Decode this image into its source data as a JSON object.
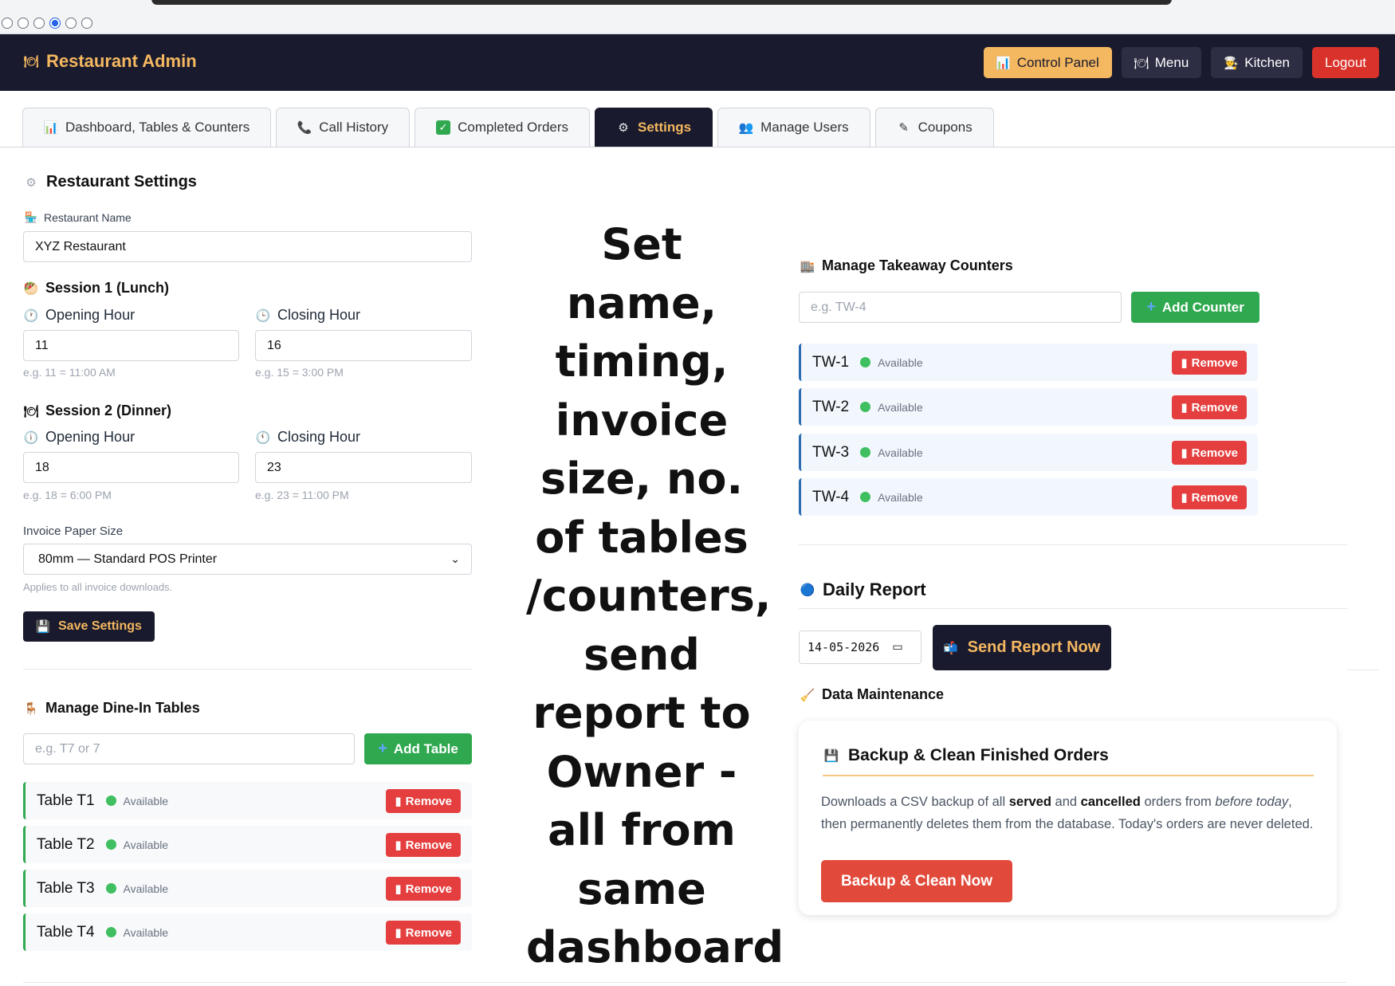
{
  "browser": {
    "dots": 6,
    "active_dot": 4
  },
  "navbar": {
    "brand": "Restaurant Admin",
    "brand_icon": "plate-icon",
    "buttons": [
      {
        "label": "Control Panel",
        "icon": "chart-icon"
      },
      {
        "label": "Menu",
        "icon": "plate-icon"
      },
      {
        "label": "Kitchen",
        "icon": "chef-icon"
      },
      {
        "label": "Logout"
      }
    ]
  },
  "tabs": [
    {
      "label": "Dashboard, Tables & Counters",
      "icon": "chart-icon"
    },
    {
      "label": "Call History",
      "icon": "phone-icon"
    },
    {
      "label": "Completed Orders",
      "icon": "check-icon"
    },
    {
      "label": "Settings",
      "icon": "gear-icon",
      "active": true
    },
    {
      "label": "Manage Users",
      "icon": "users-icon"
    },
    {
      "label": "Coupons",
      "icon": "tag-icon"
    }
  ],
  "settings": {
    "title": "Restaurant Settings",
    "name_label": "Restaurant Name",
    "name_value": "XYZ Restaurant",
    "session1": {
      "title": "Session 1 (Lunch)",
      "opening_label": "Opening Hour",
      "opening_value": "11",
      "opening_hint": "e.g. 11 = 11:00 AM",
      "closing_label": "Closing Hour",
      "closing_value": "16",
      "closing_hint": "e.g. 15 = 3:00 PM"
    },
    "session2": {
      "title": "Session 2 (Dinner)",
      "opening_label": "Opening Hour",
      "opening_value": "18",
      "opening_hint": "e.g. 18 = 6:00 PM",
      "closing_label": "Closing Hour",
      "closing_value": "23",
      "closing_hint": "e.g. 23 = 11:00 PM"
    },
    "invoice_label": "Invoice Paper Size",
    "invoice_value": "80mm — Standard POS Printer",
    "invoice_hint": "Applies to all invoice downloads.",
    "save_label": "Save Settings"
  },
  "tables": {
    "title": "Manage Dine-In Tables",
    "input_placeholder": "e.g. T7 or 7",
    "add_label": "Add Table",
    "remove_label": "Remove",
    "items": [
      {
        "name": "Table T1",
        "status": "Available"
      },
      {
        "name": "Table T2",
        "status": "Available"
      },
      {
        "name": "Table T3",
        "status": "Available"
      },
      {
        "name": "Table T4",
        "status": "Available"
      }
    ]
  },
  "caption": "Set name, timing, invoice size, no. of tables /counters, send report to Owner - all from same dashboard",
  "counters": {
    "title": "Manage Takeaway Counters",
    "input_placeholder": "e.g. TW-4",
    "add_label": "Add Counter",
    "remove_label": "Remove",
    "items": [
      {
        "name": "TW-1",
        "status": "Available"
      },
      {
        "name": "TW-2",
        "status": "Available"
      },
      {
        "name": "TW-3",
        "status": "Available"
      },
      {
        "name": "TW-4",
        "status": "Available"
      }
    ]
  },
  "report": {
    "title": "Daily Report",
    "date_value": "14-05-2026",
    "send_label": "Send Report Now"
  },
  "maintenance": {
    "title": "Data Maintenance",
    "card_title": "Backup & Clean Finished Orders",
    "text_1": "Downloads a CSV backup of all ",
    "text_served": "served",
    "text_2": " and ",
    "text_cancelled": "cancelled",
    "text_3": " orders from ",
    "text_before": "before today",
    "text_4": ", then permanently deletes them from the database. Today's orders are never deleted.",
    "button_label": "Backup & Clean Now"
  },
  "colors": {
    "navy": "#1a1a2e",
    "gold": "#f4b860",
    "green": "#2fa84f",
    "red": "#e53e3e"
  }
}
